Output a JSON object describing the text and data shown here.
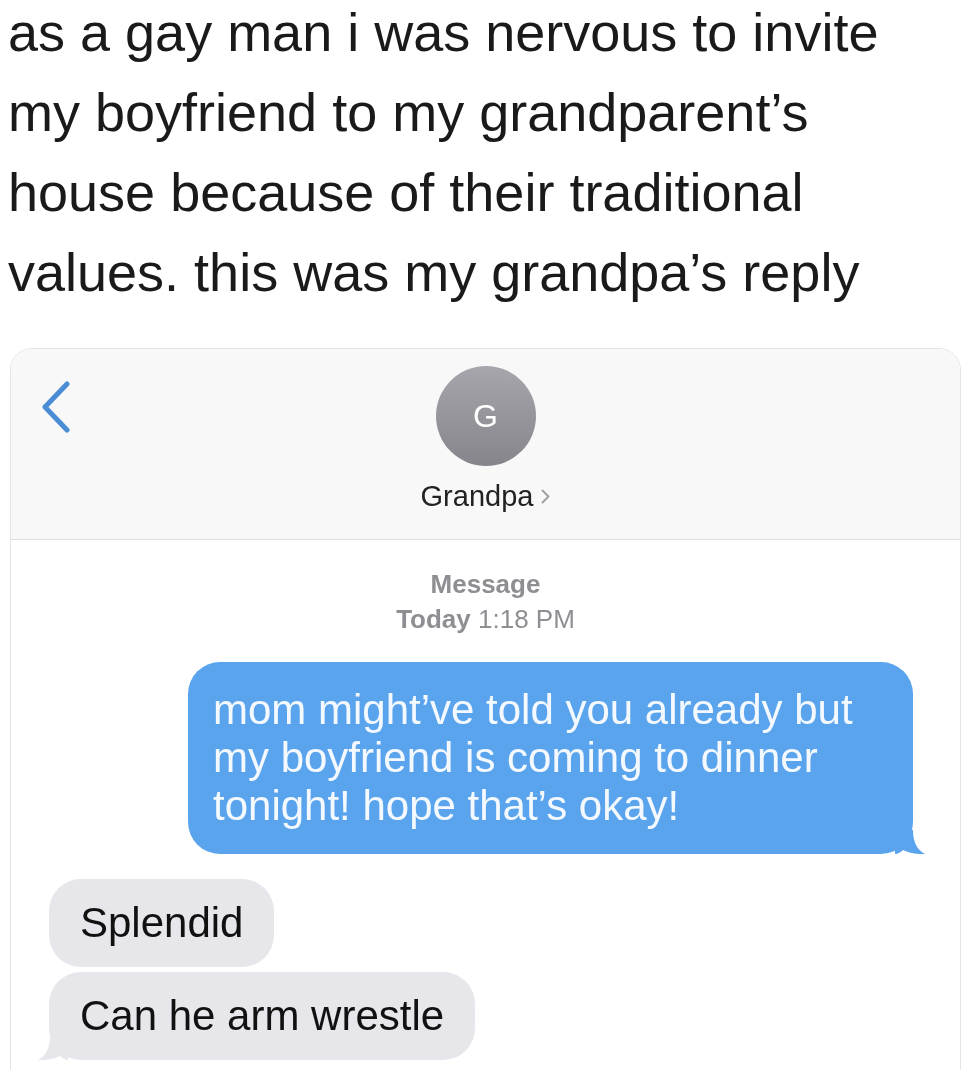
{
  "caption": "as a gay man i was nervous to invite my boyfriend to my grandparent’s house because of their traditional values. this was my grandpa’s reply",
  "screenshot": {
    "contact": {
      "initial": "G",
      "name": "Grandpa"
    },
    "thread_header": {
      "service": "Message",
      "timestamp": "**Today** 1:18 PM"
    },
    "messages": [
      {
        "kind": "sent",
        "text": "mom might’ve told you already but my boyfriend is coming to dinner tonight! hope that’s okay!",
        "tail": true
      },
      {
        "kind": "received",
        "text": "Splendid",
        "tail": false
      },
      {
        "kind": "received",
        "text": "Can he arm wrestle",
        "tail": true
      }
    ]
  }
}
